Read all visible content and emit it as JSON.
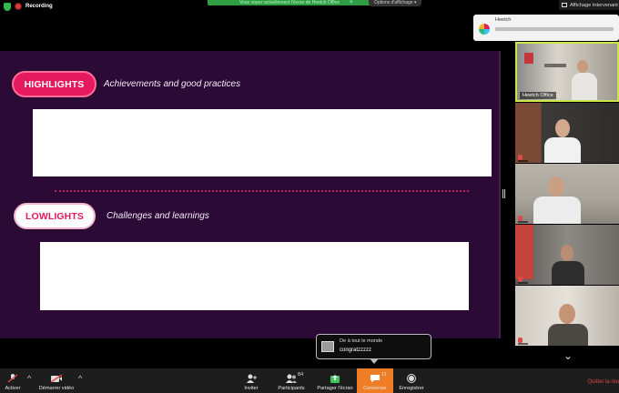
{
  "topbar": {
    "recording_label": "Recording",
    "banner_text": "Vous voyez actuellement l'écran de Heetch Office",
    "banner_close": "×",
    "options_label": "Options d'affichage ▾",
    "view_label": "Affichage Intervenant"
  },
  "slide": {
    "highlights_label": "HIGHLIGHTS",
    "highlights_subtitle": "Achievements and good practices",
    "lowlights_label": "LOWLIGHTS",
    "lowlights_subtitle": "Challenges and learnings",
    "colors": {
      "background": "#2b0a35",
      "accent": "#e5195e"
    }
  },
  "notification": {
    "app": "Heetch",
    "icon": "slack-icon"
  },
  "participants": [
    {
      "name": "Heetch Office",
      "active": true
    },
    {
      "name": "",
      "active": false
    },
    {
      "name": "",
      "active": false
    },
    {
      "name": "",
      "active": false
    },
    {
      "name": "",
      "active": false
    }
  ],
  "chat_popup": {
    "from": "De  à tout le monde",
    "message": "congratzzzzz"
  },
  "toolbar": {
    "mute_label": "Activer",
    "video_label": "Démarrer vidéo",
    "invite_label": "Inviter",
    "participants_label": "Participants",
    "participants_count": "84",
    "share_label": "Partager l'écran",
    "chat_label": "Converser",
    "chat_count": "11",
    "record_label": "Enregistrer",
    "leave_label": "Quitter la réu",
    "colors": {
      "active": "#ef7d26",
      "leave": "#e04545"
    }
  }
}
